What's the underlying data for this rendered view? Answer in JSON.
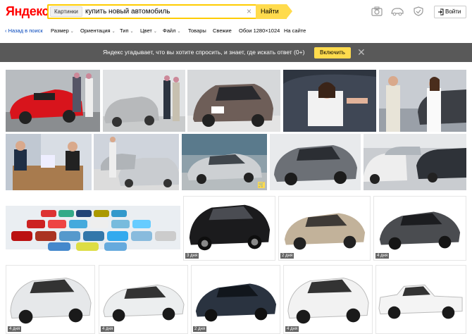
{
  "header": {
    "logo": "Яндекс",
    "search": {
      "category": "Картинки",
      "query": "купить новый автомобиль",
      "clear_icon": "close-icon"
    },
    "find_button": "Найти",
    "login_button": "Войти",
    "icons": [
      "camera-icon",
      "car-icon",
      "shield-icon"
    ]
  },
  "filters": {
    "back": "‹ Назад в поиск",
    "items": [
      "Размер",
      "Ориентация",
      "Тип",
      "Цвет",
      "Файл",
      "Товары",
      "Свежие",
      "Обои 1280×1024",
      "На сайте"
    ]
  },
  "banner": {
    "text": "Яндекс угадывает, что вы хотите спросить, и знает, где искать ответ (0+)",
    "button": "Включить"
  },
  "results": {
    "row3_ages": [
      "3 дня",
      "2 дня",
      "4 дня"
    ],
    "row4_ages": [
      "4 дня",
      "4 дня",
      "2 дня",
      "4 дня"
    ]
  },
  "colors": {
    "accent": "#ffdb4d",
    "logo_red": "#ff0000",
    "banner_bg": "#595959"
  }
}
